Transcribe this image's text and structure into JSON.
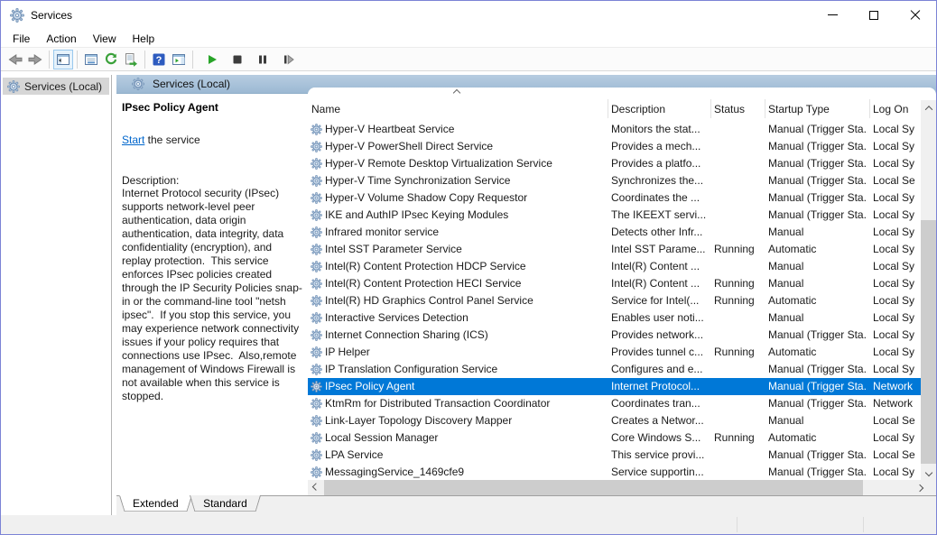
{
  "window": {
    "title": "Services",
    "controls": [
      "minimize",
      "maximize",
      "close"
    ]
  },
  "menu": {
    "items": [
      "File",
      "Action",
      "View",
      "Help"
    ]
  },
  "toolbar": {
    "icons": [
      "back",
      "forward",
      "show-console-tree",
      "properties",
      "refresh",
      "export-list",
      "help",
      "show-action-pane",
      "start-service",
      "stop-service",
      "pause-service",
      "restart-service"
    ]
  },
  "tree": {
    "items": [
      {
        "label": "Services (Local)",
        "selected": true
      }
    ]
  },
  "content_header": {
    "title": "Services (Local)"
  },
  "detail_pane": {
    "service_name": "IPsec Policy Agent",
    "start_link": "Start",
    "start_suffix": " the service",
    "description_label": "Description:",
    "description": "Internet Protocol security (IPsec) supports network-level peer authentication, data origin authentication, data integrity, data confidentiality (encryption), and replay protection.  This service enforces IPsec policies created through the IP Security Policies snap-in or the command-line tool \"netsh ipsec\".  If you stop this service, you may experience network connectivity issues if your policy requires that connections use IPsec.  Also,remote management of Windows Firewall is not available when this service is stopped."
  },
  "service_table": {
    "columns": [
      "Name",
      "Description",
      "Status",
      "Startup Type",
      "Log On"
    ],
    "sort_column": "Name",
    "rows": [
      {
        "name": "Hyper-V Heartbeat Service",
        "description": "Monitors the stat...",
        "status": "",
        "startup_type": "Manual (Trigger Sta...",
        "log_on": "Local Sy"
      },
      {
        "name": "Hyper-V PowerShell Direct Service",
        "description": "Provides a mech...",
        "status": "",
        "startup_type": "Manual (Trigger Sta...",
        "log_on": "Local Sy"
      },
      {
        "name": "Hyper-V Remote Desktop Virtualization Service",
        "description": "Provides a platfo...",
        "status": "",
        "startup_type": "Manual (Trigger Sta...",
        "log_on": "Local Sy"
      },
      {
        "name": "Hyper-V Time Synchronization Service",
        "description": "Synchronizes the...",
        "status": "",
        "startup_type": "Manual (Trigger Sta...",
        "log_on": "Local Se"
      },
      {
        "name": "Hyper-V Volume Shadow Copy Requestor",
        "description": "Coordinates the ...",
        "status": "",
        "startup_type": "Manual (Trigger Sta...",
        "log_on": "Local Sy"
      },
      {
        "name": "IKE and AuthIP IPsec Keying Modules",
        "description": "The IKEEXT servi...",
        "status": "",
        "startup_type": "Manual (Trigger Sta...",
        "log_on": "Local Sy"
      },
      {
        "name": "Infrared monitor service",
        "description": "Detects other Infr...",
        "status": "",
        "startup_type": "Manual",
        "log_on": "Local Sy"
      },
      {
        "name": "Intel SST Parameter Service",
        "description": "Intel SST Parame...",
        "status": "Running",
        "startup_type": "Automatic",
        "log_on": "Local Sy"
      },
      {
        "name": "Intel(R) Content Protection HDCP Service",
        "description": "Intel(R) Content ...",
        "status": "",
        "startup_type": "Manual",
        "log_on": "Local Sy"
      },
      {
        "name": "Intel(R) Content Protection HECI Service",
        "description": "Intel(R) Content ...",
        "status": "Running",
        "startup_type": "Manual",
        "log_on": "Local Sy"
      },
      {
        "name": "Intel(R) HD Graphics Control Panel Service",
        "description": "Service for Intel(...",
        "status": "Running",
        "startup_type": "Automatic",
        "log_on": "Local Sy"
      },
      {
        "name": "Interactive Services Detection",
        "description": "Enables user noti...",
        "status": "",
        "startup_type": "Manual",
        "log_on": "Local Sy"
      },
      {
        "name": "Internet Connection Sharing (ICS)",
        "description": "Provides network...",
        "status": "",
        "startup_type": "Manual (Trigger Sta...",
        "log_on": "Local Sy"
      },
      {
        "name": "IP Helper",
        "description": "Provides tunnel c...",
        "status": "Running",
        "startup_type": "Automatic",
        "log_on": "Local Sy"
      },
      {
        "name": "IP Translation Configuration Service",
        "description": "Configures and e...",
        "status": "",
        "startup_type": "Manual (Trigger Sta...",
        "log_on": "Local Sy"
      },
      {
        "name": "IPsec Policy Agent",
        "description": "Internet Protocol...",
        "status": "",
        "startup_type": "Manual (Trigger Sta...",
        "log_on": "Network",
        "selected": true
      },
      {
        "name": "KtmRm for Distributed Transaction Coordinator",
        "description": "Coordinates tran...",
        "status": "",
        "startup_type": "Manual (Trigger Sta...",
        "log_on": "Network"
      },
      {
        "name": "Link-Layer Topology Discovery Mapper",
        "description": "Creates a Networ...",
        "status": "",
        "startup_type": "Manual",
        "log_on": "Local Se"
      },
      {
        "name": "Local Session Manager",
        "description": "Core Windows S...",
        "status": "Running",
        "startup_type": "Automatic",
        "log_on": "Local Sy"
      },
      {
        "name": "LPA Service",
        "description": "This service provi...",
        "status": "",
        "startup_type": "Manual (Trigger Sta...",
        "log_on": "Local Se"
      },
      {
        "name": "MessagingService_1469cfe9",
        "description": "Service supportin...",
        "status": "",
        "startup_type": "Manual (Trigger Sta...",
        "log_on": "Local Sy"
      }
    ]
  },
  "tabs": {
    "items": [
      {
        "label": "Extended",
        "active": true
      },
      {
        "label": "Standard",
        "active": false
      }
    ]
  },
  "colors": {
    "selection_blue": "#0078d7",
    "link_blue": "#0066cc",
    "window_border": "#7b83d6",
    "header_band_top": "#b7cde1",
    "header_band_bottom": "#9cb9d3"
  }
}
